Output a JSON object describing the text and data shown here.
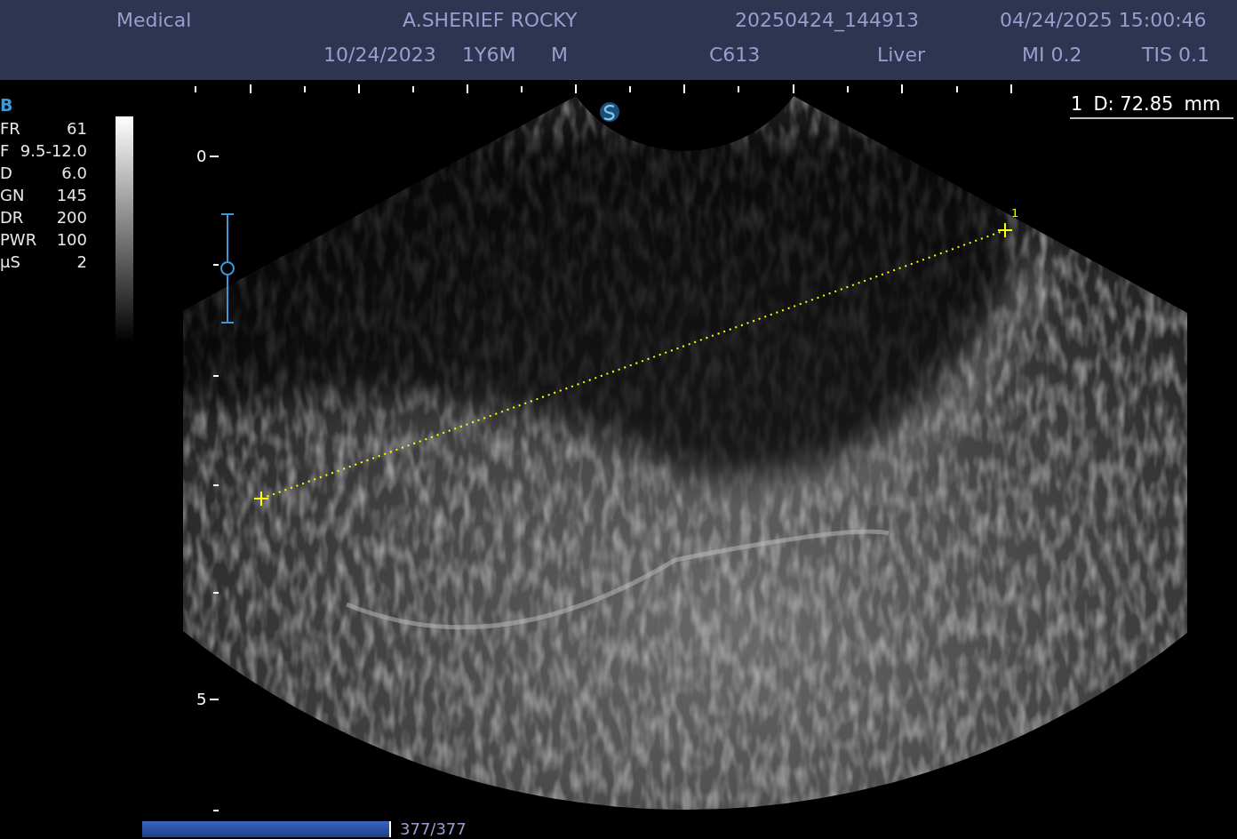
{
  "header": {
    "row_1": [
      "Medical",
      "A.SHERIEF ROCKY",
      "20250424_144913",
      "04/24/2025 15:00:46"
    ],
    "row_2": [
      "10/24/2023",
      "1Y6M",
      "M",
      "C613",
      "Liver",
      "MI 0.2",
      "TIS 0.1"
    ]
  },
  "mode": "B",
  "parameters": [
    {
      "name": "FR",
      "value": "61"
    },
    {
      "name": "F",
      "value": "9.5-12.0"
    },
    {
      "name": "D",
      "value": "6.0"
    },
    {
      "name": "GN",
      "value": "145"
    },
    {
      "name": "DR",
      "value": "200"
    },
    {
      "name": "PWR",
      "value": "100"
    },
    {
      "name": "µS",
      "value": "2"
    }
  ],
  "depth_labels": [
    "0",
    "5"
  ],
  "measurement": {
    "number": "1",
    "reading": "D: 72.85",
    "unit": "mm",
    "marker_label": "1"
  },
  "cine": {
    "level": 1,
    "reading": "377/377"
  }
}
